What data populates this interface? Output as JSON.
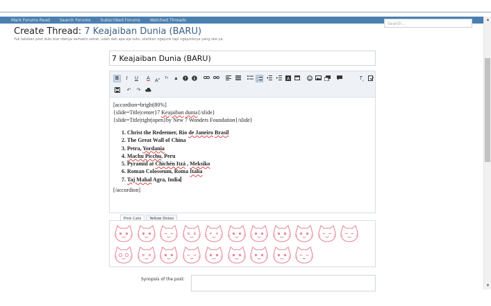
{
  "navbar": {
    "links": [
      "Mark Forums Read",
      "Search Forums",
      "Subscribed Forums",
      "Watched Threads"
    ],
    "search_placeholder": "Search..."
  },
  "page": {
    "title_prefix": "Create Thread:",
    "thread_name": "7 Keajaiban Dunia (BARU)",
    "description": "Yuk lakukan post dulu biar idenya semakin sehat, udah dah apa aja tulis, silahkan ngejunk tapi ngejunknya yang oke ya."
  },
  "title_input": {
    "value": "7 Keajaiban Dunia (BARU)"
  },
  "editor": {
    "lines_top": [
      "[accordion=bright|80%]"
    ],
    "slide_line_1_pre": "{slide=Title|center}7 ",
    "slide_line_1_sp1": "Keajaiban",
    "slide_line_1_mid": " ",
    "slide_line_1_sp2": "dunia",
    "slide_line_1_post": "{/slide}",
    "slide_line_2": "{slide=Title|right|open}by New 7 Wonders Foundation{/slide}",
    "wonders": [
      {
        "pre": "Christ the Redeemer, Rio ",
        "sp1": "de Janeiro",
        "mid": " ",
        "sp2": "Brasil",
        "post": ""
      },
      {
        "pre": "The Great Wall of China",
        "sp1": "",
        "mid": "",
        "sp2": "",
        "post": ""
      },
      {
        "pre": "Petra, ",
        "sp1": "Yordania",
        "mid": "",
        "sp2": "",
        "post": ""
      },
      {
        "pre": "",
        "sp1": "Machu Picchu",
        "mid": ", Peru",
        "sp2": "",
        "post": ""
      },
      {
        "pre": "Pyramid at ",
        "sp1": "Chichén Itzá",
        "mid": " , ",
        "sp2": "Meksiko",
        "post": ""
      },
      {
        "pre": "Roman Colosseum, Roma ",
        "sp1": "Italia",
        "mid": "",
        "sp2": "",
        "post": ""
      },
      {
        "pre": "",
        "sp1": "Taj Mahal",
        "mid": " Agra, India",
        "sp2": "",
        "post": ""
      }
    ],
    "closing": "[/accordion]"
  },
  "smilie_tabs": [
    "Pink Cats",
    "Yellow Onion"
  ],
  "smilie_color": "#e6899a",
  "synopsis": {
    "label": "Synopsis of the post:",
    "value": ""
  },
  "colors": {
    "nav": "#4a7fb0",
    "title_link": "#3a5f86",
    "toolbar_bg": "#eef2f7"
  }
}
